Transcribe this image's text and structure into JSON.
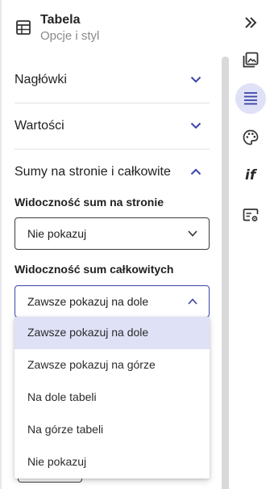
{
  "header": {
    "title": "Tabela",
    "subtitle": "Opcje i styl",
    "icon": "table-icon"
  },
  "sections": [
    {
      "label": "Nagłówki",
      "expanded": false
    },
    {
      "label": "Wartości",
      "expanded": false
    },
    {
      "label": "Sumy na stronie i całkowite",
      "expanded": true
    }
  ],
  "page_totals": {
    "label": "Widoczność sum na stronie",
    "value": "Nie pokazuj"
  },
  "grand_totals": {
    "label": "Widoczność sum całkowitych",
    "value": "Zawsze pokazuj na dole",
    "options": [
      "Zawsze pokazuj na dole",
      "Zawsze pokazuj na górze",
      "Na dole tabeli",
      "Na górze tabeli",
      "Nie pokazuj"
    ],
    "selected_index": 0
  },
  "rail": {
    "icons": [
      "collapse-icon",
      "image-icon",
      "list-icon",
      "palette-icon",
      "if-icon",
      "settings-card-icon"
    ],
    "if_text": "if",
    "active": "list-icon"
  },
  "colors": {
    "accent": "#3b44a8",
    "selected_bg": "#dfe1f7",
    "chevron": "#3b44a8"
  }
}
